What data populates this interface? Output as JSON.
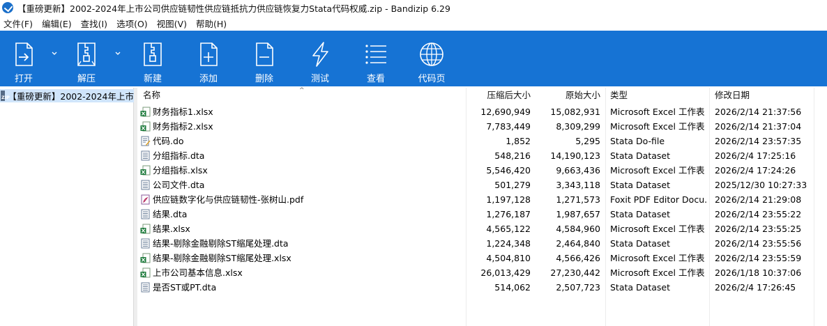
{
  "window": {
    "title": "【重磅更新】2002-2024年上市公司供应链韧性供应链抵抗力供应链恢复力Stata代码权威.zip - Bandizip 6.29"
  },
  "menu": [
    "文件(F)",
    "编辑(E)",
    "查找(I)",
    "选项(O)",
    "视图(V)",
    "帮助(H)"
  ],
  "toolbar": {
    "open": "打开",
    "extract": "解压",
    "new": "新建",
    "add": "添加",
    "delete": "删除",
    "test": "测试",
    "view": "查看",
    "codepage": "代码页"
  },
  "tree": {
    "root_label": "【重磅更新】2002-2024年上市"
  },
  "columns": {
    "name": "名称",
    "packed": "压缩后大小",
    "original": "原始大小",
    "type": "类型",
    "modified": "修改日期"
  },
  "files": [
    {
      "name": "财务指标1.xlsx",
      "packed": "12,690,949",
      "original": "15,082,931",
      "type": "Microsoft Excel 工作表",
      "modified": "2026/2/14 21:37:56",
      "icon": "excel-icon"
    },
    {
      "name": "财务指标2.xlsx",
      "packed": "7,783,449",
      "original": "8,309,299",
      "type": "Microsoft Excel 工作表",
      "modified": "2026/2/14 21:37:04",
      "icon": "excel-icon"
    },
    {
      "name": "代码.do",
      "packed": "1,852",
      "original": "5,295",
      "type": "Stata Do-file",
      "modified": "2026/2/14 23:57:35",
      "icon": "do-file-icon"
    },
    {
      "name": "分组指标.dta",
      "packed": "548,216",
      "original": "14,190,123",
      "type": "Stata Dataset",
      "modified": "2026/2/4 17:25:16",
      "icon": "dta-icon"
    },
    {
      "name": "分组指标.xlsx",
      "packed": "5,546,420",
      "original": "9,663,436",
      "type": "Microsoft Excel 工作表",
      "modified": "2026/2/4 17:24:26",
      "icon": "excel-icon"
    },
    {
      "name": "公司文件.dta",
      "packed": "501,279",
      "original": "3,343,118",
      "type": "Stata Dataset",
      "modified": "2025/12/30 10:27:33",
      "icon": "dta-icon"
    },
    {
      "name": "供应链数字化与供应链韧性-张树山.pdf",
      "packed": "1,197,128",
      "original": "1,271,573",
      "type": "Foxit PDF Editor Docu...",
      "modified": "2026/2/14 21:29:08",
      "icon": "pdf-icon"
    },
    {
      "name": "结果.dta",
      "packed": "1,276,187",
      "original": "1,987,657",
      "type": "Stata Dataset",
      "modified": "2026/2/14 23:55:22",
      "icon": "dta-icon"
    },
    {
      "name": "结果.xlsx",
      "packed": "4,565,122",
      "original": "4,584,960",
      "type": "Microsoft Excel 工作表",
      "modified": "2026/2/14 23:55:25",
      "icon": "excel-icon"
    },
    {
      "name": "结果-剔除金融剔除ST缩尾处理.dta",
      "packed": "1,224,348",
      "original": "2,464,840",
      "type": "Stata Dataset",
      "modified": "2026/2/14 23:55:56",
      "icon": "dta-icon"
    },
    {
      "name": "结果-剔除金融剔除ST缩尾处理.xlsx",
      "packed": "4,504,810",
      "original": "4,566,426",
      "type": "Microsoft Excel 工作表",
      "modified": "2026/2/14 23:55:59",
      "icon": "excel-icon"
    },
    {
      "name": "上市公司基本信息.xlsx",
      "packed": "26,013,429",
      "original": "27,230,442",
      "type": "Microsoft Excel 工作表",
      "modified": "2026/1/18 10:37:06",
      "icon": "excel-icon"
    },
    {
      "name": "是否ST或PT.dta",
      "packed": "514,062",
      "original": "2,507,723",
      "type": "Stata Dataset",
      "modified": "2026/2/4 17:26:45",
      "icon": "dta-icon"
    }
  ]
}
